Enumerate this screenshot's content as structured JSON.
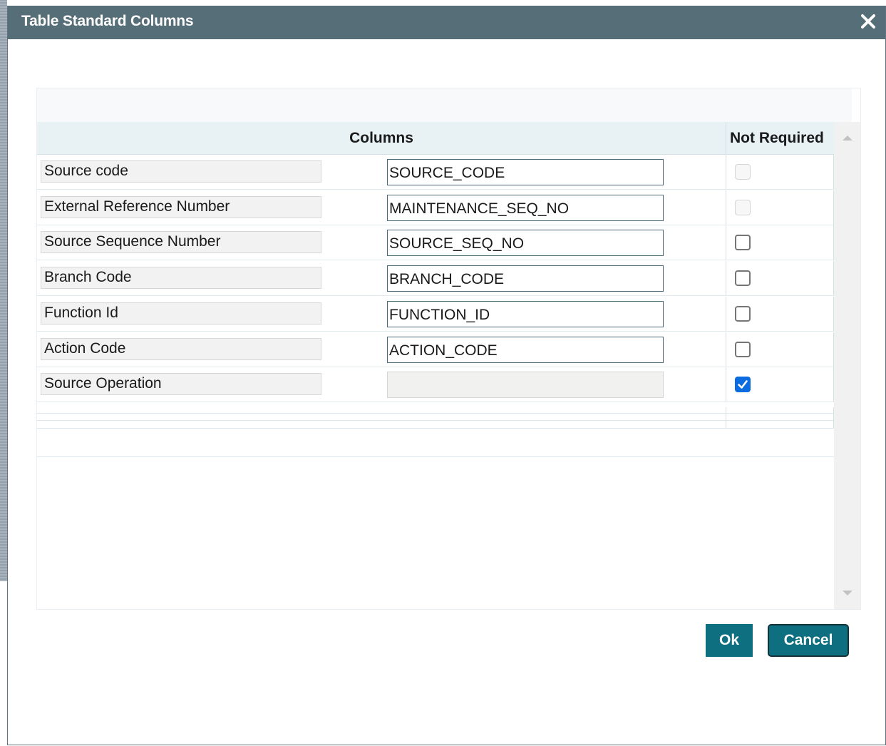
{
  "dialog": {
    "title": "Table Standard Columns",
    "close_icon": "close-icon"
  },
  "grid": {
    "headers": {
      "columns": "Columns",
      "not_required": "Not Required"
    },
    "rows": [
      {
        "label": "Source code",
        "value": "SOURCE_CODE",
        "input_disabled": false,
        "not_required": false,
        "checkbox_disabled": true
      },
      {
        "label": "External Reference Number",
        "value": "MAINTENANCE_SEQ_NO",
        "input_disabled": false,
        "not_required": false,
        "checkbox_disabled": true
      },
      {
        "label": "Source Sequence Number",
        "value": "SOURCE_SEQ_NO",
        "input_disabled": false,
        "not_required": false,
        "checkbox_disabled": false
      },
      {
        "label": "Branch Code",
        "value": "BRANCH_CODE",
        "input_disabled": false,
        "not_required": false,
        "checkbox_disabled": false
      },
      {
        "label": "Function Id",
        "value": "FUNCTION_ID",
        "input_disabled": false,
        "not_required": false,
        "checkbox_disabled": false
      },
      {
        "label": "Action Code",
        "value": "ACTION_CODE",
        "input_disabled": false,
        "not_required": false,
        "checkbox_disabled": false
      },
      {
        "label": "Source Operation",
        "value": "",
        "input_disabled": true,
        "not_required": true,
        "checkbox_disabled": false
      }
    ]
  },
  "buttons": {
    "ok": "Ok",
    "cancel": "Cancel"
  },
  "colors": {
    "titlebar": "#566e78",
    "header_row": "#e8f2f5",
    "button": "#0d6f80",
    "checkbox_checked": "#0a6ce0"
  },
  "icons": {
    "close": "close-icon",
    "scroll_up": "scroll-up-arrow-icon",
    "scroll_down": "scroll-down-arrow-icon",
    "check": "checkmark-icon"
  }
}
